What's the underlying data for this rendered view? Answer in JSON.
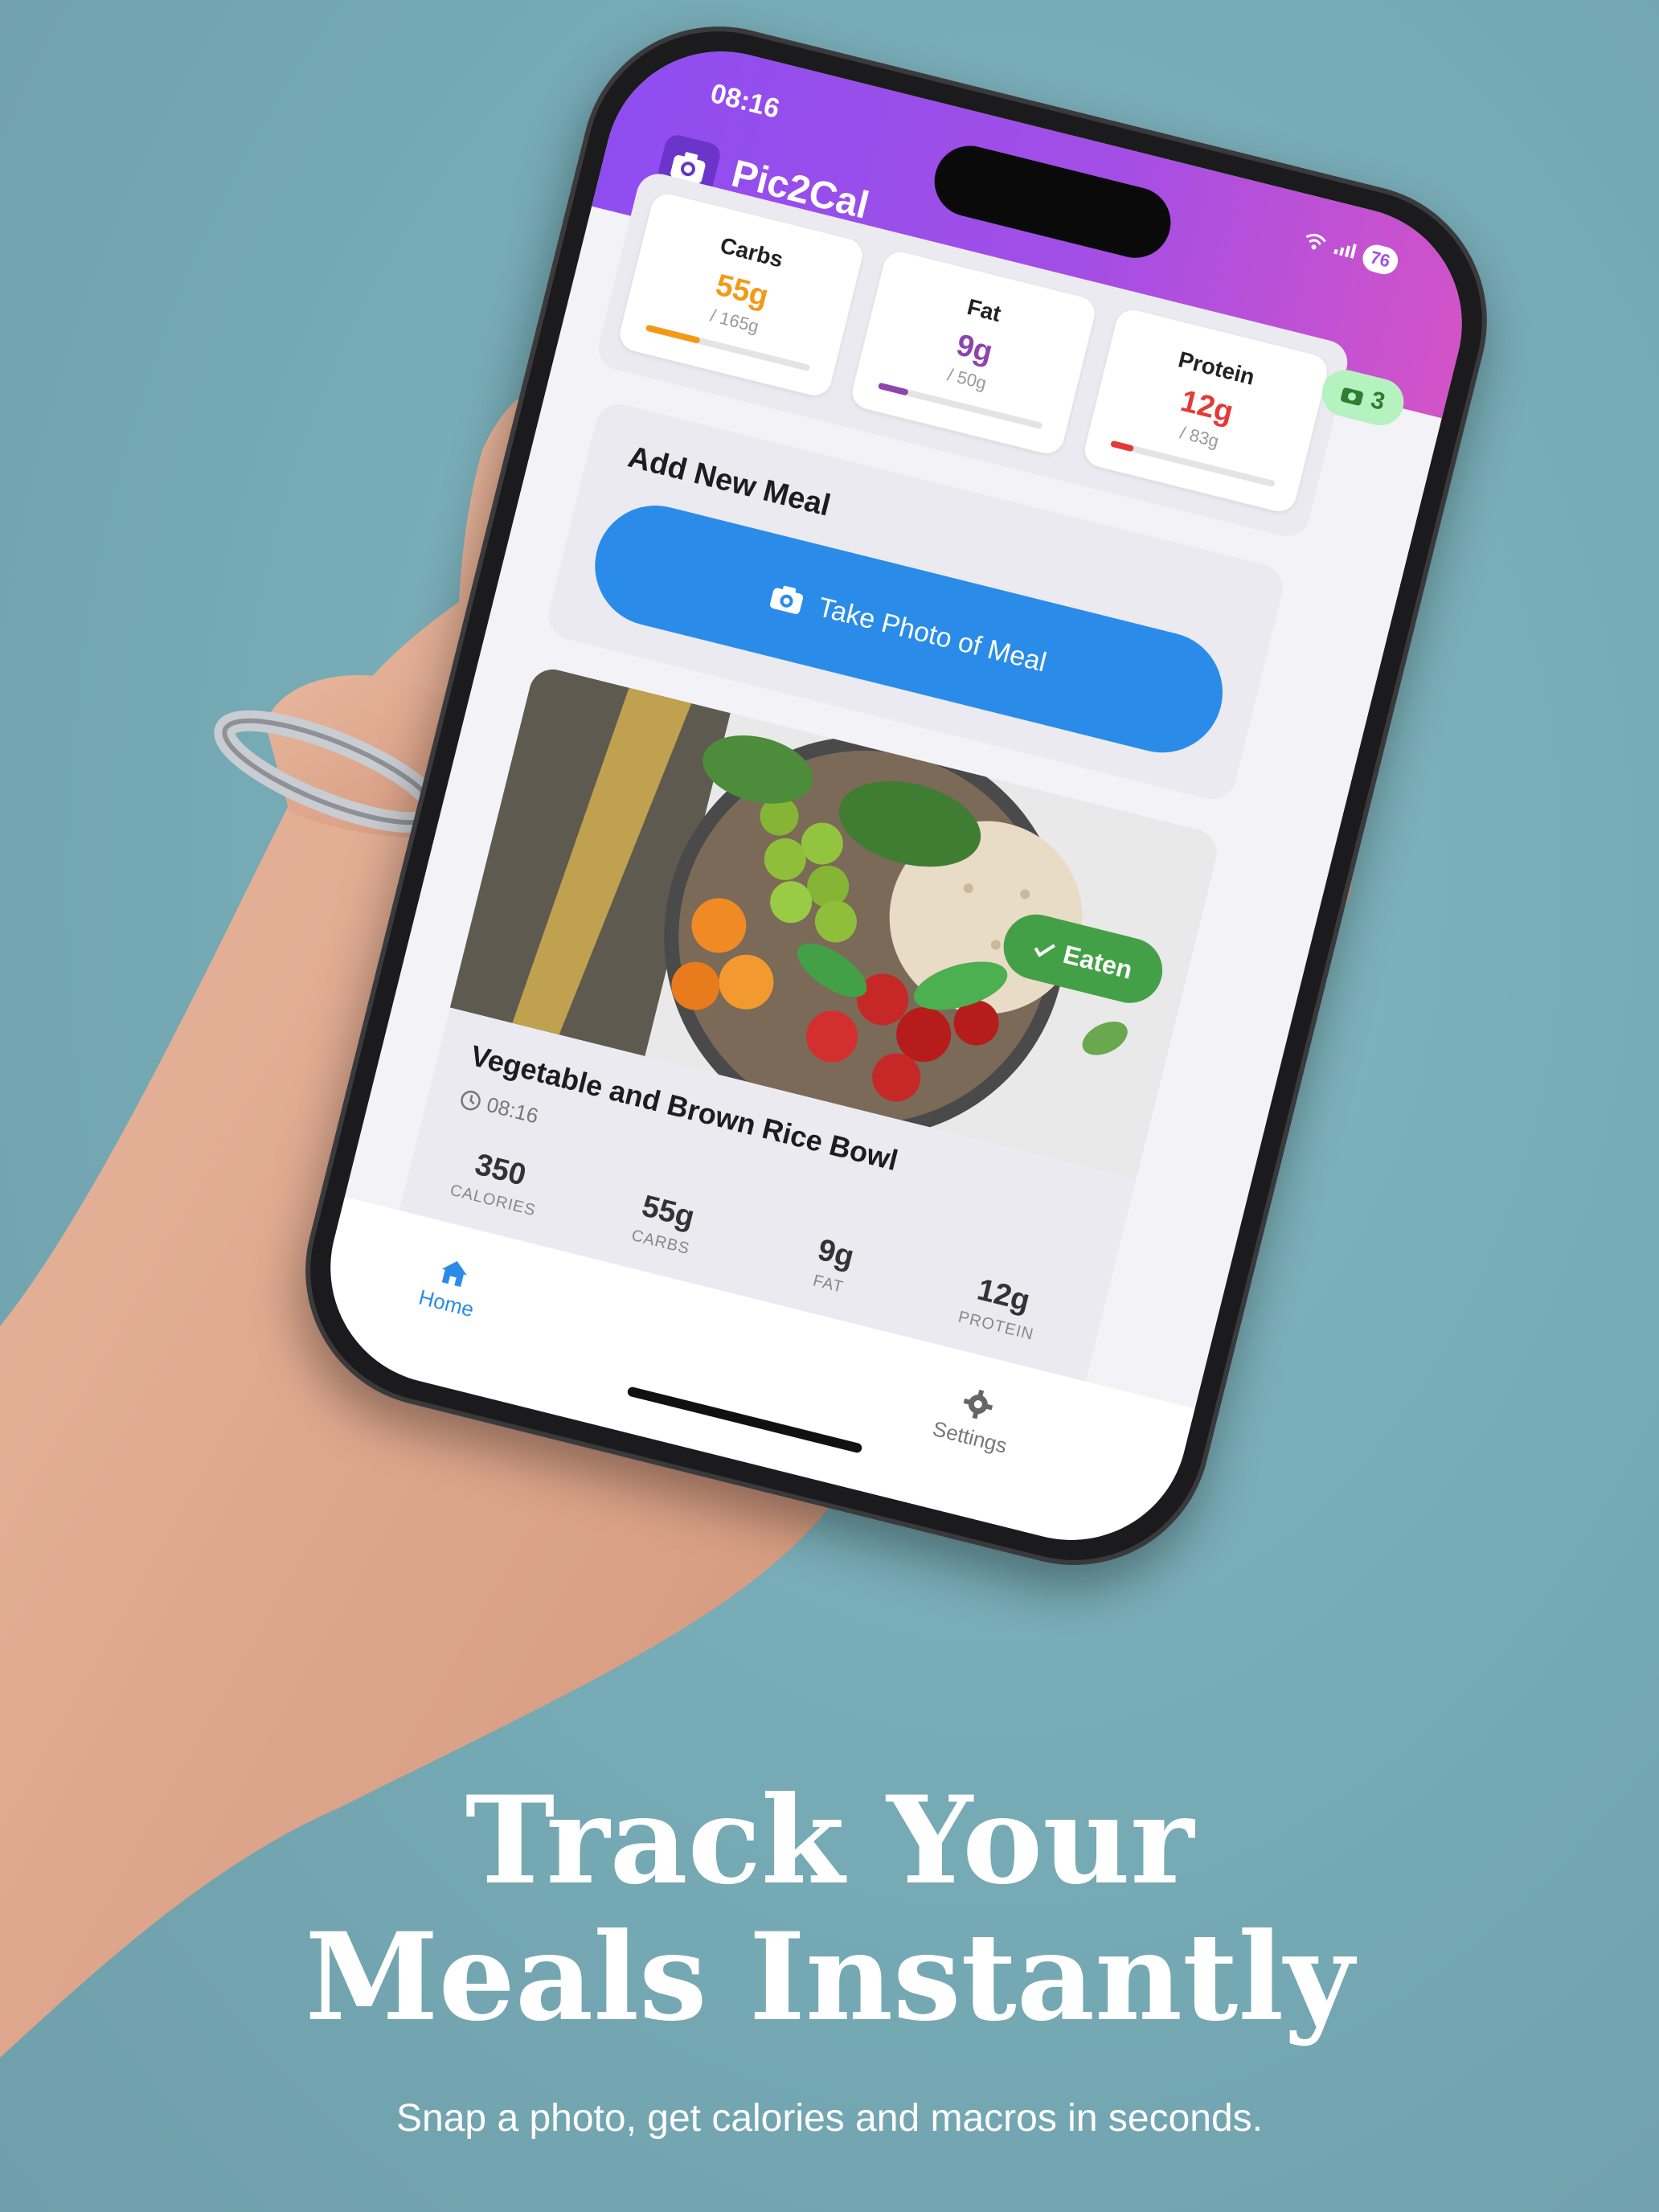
{
  "status": {
    "time": "08:16",
    "battery": "76"
  },
  "app": {
    "title": "Pic2Cal",
    "photo_count": "3"
  },
  "macros": [
    {
      "name": "Carbs",
      "value": "55g",
      "goal": "/ 165g",
      "color": "#f29a16",
      "progress": 0.33
    },
    {
      "name": "Fat",
      "value": "9g",
      "goal": "/ 50g",
      "color": "#8e44ad",
      "progress": 0.18
    },
    {
      "name": "Protein",
      "value": "12g",
      "goal": "/ 83g",
      "color": "#e53935",
      "progress": 0.14
    }
  ],
  "add_meal": {
    "title": "Add New Meal",
    "button_label": "Take Photo of Meal"
  },
  "meal": {
    "badge": "Eaten",
    "name": "Vegetable and Brown Rice Bowl",
    "time": "08:16",
    "stats": [
      {
        "value": "350",
        "label": "CALORIES"
      },
      {
        "value": "55g",
        "label": "CARBS"
      },
      {
        "value": "9g",
        "label": "FAT"
      },
      {
        "value": "12g",
        "label": "PROTEIN"
      }
    ]
  },
  "nav": {
    "home": "Home",
    "settings": "Settings"
  },
  "marketing": {
    "headline_line1": "Track Your",
    "headline_line2": "Meals Instantly",
    "subhead": "Snap a photo, get calories and macros in seconds."
  },
  "colors": {
    "accent": "#2a8ce8",
    "header_start": "#8f4df0",
    "header_end": "#d253c8",
    "eaten": "#43a047",
    "background": "#79aeb8"
  },
  "icons": [
    "camera-icon",
    "clock-icon",
    "check-icon",
    "home-icon",
    "gear-icon",
    "wifi-icon",
    "signal-icon"
  ]
}
